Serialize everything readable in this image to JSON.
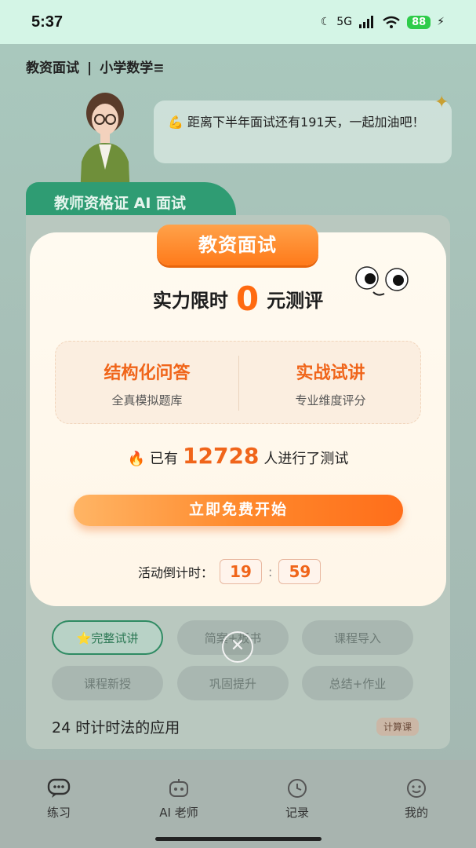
{
  "status_bar": {
    "time": "5:37",
    "network": "5G",
    "battery": "88"
  },
  "header": {
    "section": "教资面试",
    "separator": "|",
    "subject": "小学数学≡"
  },
  "speech": {
    "text": "💪 距离下半年面试还有191天，一起加油吧！"
  },
  "ai_tab": {
    "label": "教师资格证 AI 面试"
  },
  "modal": {
    "badge": "教资面试",
    "headline_pre": "实力限时",
    "headline_zero": "0",
    "headline_post": "元测评",
    "features": [
      {
        "title": "结构化问答",
        "subtitle": "全真模拟题库"
      },
      {
        "title": "实战试讲",
        "subtitle": "专业维度评分"
      }
    ],
    "count_pre": "已有",
    "count_num": "12728",
    "count_post": "人进行了测试",
    "cta": "立即免费开始",
    "countdown_label": "活动倒计时：",
    "countdown_min": "19",
    "countdown_colon": ":",
    "countdown_sec": "59",
    "close_icon": "close-icon"
  },
  "chips": [
    "⭐完整试讲",
    "简案+板书",
    "课程导入",
    "课程新授",
    "巩固提升",
    "总结+作业"
  ],
  "lesson": {
    "title": "24 时计时法的应用",
    "tag": "计算课"
  },
  "bottom_nav": [
    {
      "label": "练习",
      "icon": "chat-icon"
    },
    {
      "label": "AI 老师",
      "icon": "robot-icon"
    },
    {
      "label": "记录",
      "icon": "clock-icon"
    },
    {
      "label": "我的",
      "icon": "smile-icon"
    }
  ]
}
